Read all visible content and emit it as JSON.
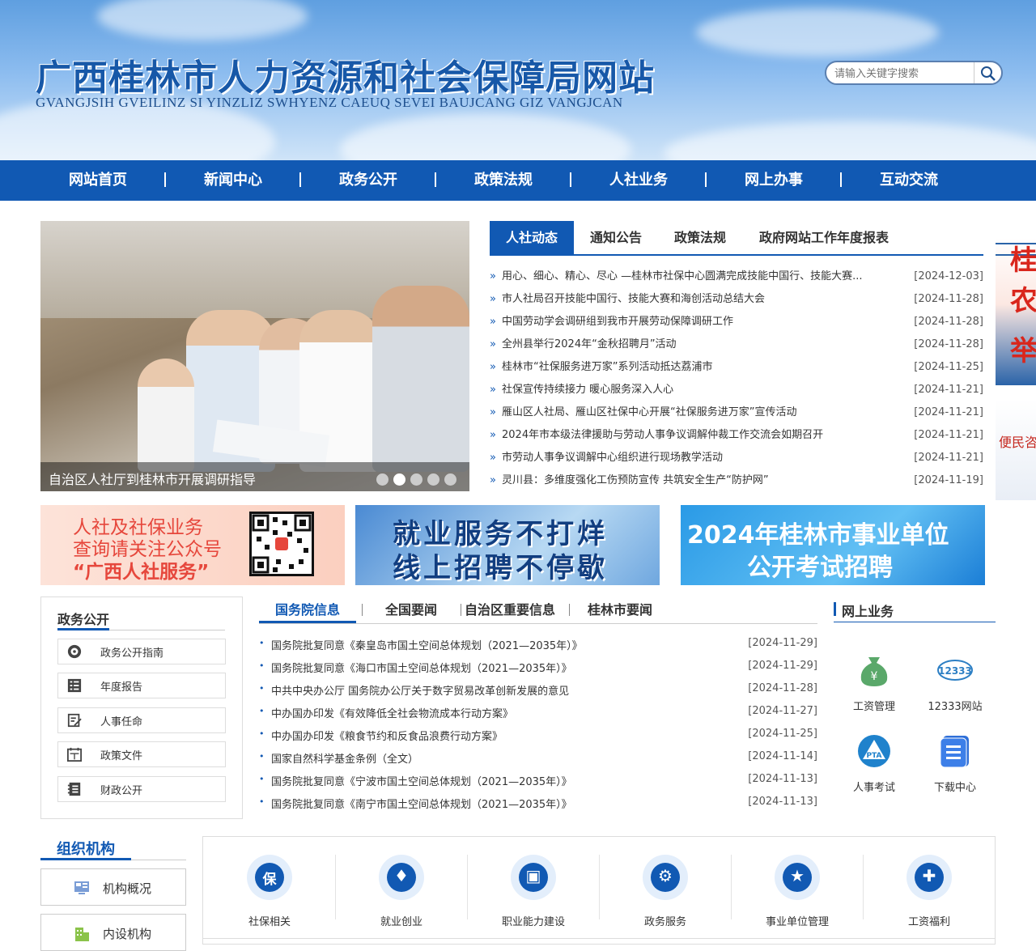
{
  "header": {
    "title": "广西桂林市人力资源和社会保障局网站",
    "subtitle": "GVANGJSIH GVEILINZ SI YINZLIZ SWHYENZ CAEUQ SEVEI BAUJCANG GIZ VANGJCAN",
    "search_placeholder": "请输入关键字搜索"
  },
  "nav": [
    "网站首页",
    "新闻中心",
    "政务公开",
    "政策法规",
    "人社业务",
    "网上办事",
    "互动交流"
  ],
  "slider": {
    "caption": "自治区人社厅到桂林市开展调研指导",
    "active_dot": 2,
    "dot_count": 5
  },
  "news_tabs": [
    "人社动态",
    "通知公告",
    "政策法规",
    "政府网站工作年度报表"
  ],
  "news": [
    {
      "title": "用心、细心、精心、尽心 —桂林市社保中心圆满完成技能中国行、技能大赛...",
      "date": "[2024-12-03]"
    },
    {
      "title": "市人社局召开技能中国行、技能大赛和海创活动总结大会",
      "date": "[2024-11-28]"
    },
    {
      "title": "中国劳动学会调研组到我市开展劳动保障调研工作",
      "date": "[2024-11-28]"
    },
    {
      "title": "全州县举行2024年“金秋招聘月”活动",
      "date": "[2024-11-28]"
    },
    {
      "title": "桂林市“社保服务进万家”系列活动抵达荔浦市",
      "date": "[2024-11-25]"
    },
    {
      "title": "社保宣传持续接力 暖心服务深入人心",
      "date": "[2024-11-21]"
    },
    {
      "title": "雁山区人社局、雁山区社保中心开展“社保服务进万家”宣传活动",
      "date": "[2024-11-21]"
    },
    {
      "title": "2024年市本级法律援助与劳动人事争议调解仲裁工作交流会如期召开",
      "date": "[2024-11-21]"
    },
    {
      "title": "市劳动人事争议调解中心组织进行现场教学活动",
      "date": "[2024-11-21]"
    },
    {
      "title": "灵川县：多维度强化工伤预防宣传 共筑安全生产“防护网”",
      "date": "[2024-11-19]"
    }
  ],
  "banners": {
    "b1": [
      "人社及社保业务",
      "查询请关注公众号",
      "“广西人社服务”"
    ],
    "b2": [
      "就业服务不打烊",
      "线上招聘不停歇"
    ],
    "b3": [
      "2024年桂林市事业单位",
      "公开考试招聘"
    ]
  },
  "float_ads": {
    "ad1": [
      "桂",
      "农",
      "举"
    ],
    "ad2": "便民咨"
  },
  "gov_open": {
    "title": "政务公开",
    "items": [
      {
        "label": "政务公开指南",
        "icon": "compass-icon"
      },
      {
        "label": "年度报告",
        "icon": "list-icon"
      },
      {
        "label": "人事任命",
        "icon": "edit-icon"
      },
      {
        "label": "政策文件",
        "icon": "calendar-icon"
      },
      {
        "label": "财政公开",
        "icon": "ledger-icon"
      }
    ]
  },
  "info_tabs": [
    "国务院信息",
    "全国要闻",
    "自治区重要信息",
    "桂林市要闻"
  ],
  "info_list": [
    {
      "title": "国务院批复同意《秦皇岛市国土空间总体规划（2021—2035年）》",
      "date": "[2024-11-29]"
    },
    {
      "title": "国务院批复同意《海口市国土空间总体规划（2021—2035年）》",
      "date": "[2024-11-29]"
    },
    {
      "title": "中共中央办公厅 国务院办公厅关于数字贸易改革创新发展的意见",
      "date": "[2024-11-28]"
    },
    {
      "title": "中办国办印发《有效降低全社会物流成本行动方案》",
      "date": "[2024-11-27]"
    },
    {
      "title": "中办国办印发《粮食节约和反食品浪费行动方案》",
      "date": "[2024-11-25]"
    },
    {
      "title": "国家自然科学基金条例（全文）",
      "date": "[2024-11-14]"
    },
    {
      "title": "国务院批复同意《宁波市国土空间总体规划（2021—2035年）》",
      "date": "[2024-11-13]"
    },
    {
      "title": "国务院批复同意《南宁市国土空间总体规划（2021—2035年）》",
      "date": "[2024-11-13]"
    }
  ],
  "online": {
    "title": "网上业务",
    "items": [
      {
        "label": "工资管理",
        "icon": "money-bag-icon",
        "color": "#5aa86a",
        "badge": "¥"
      },
      {
        "label": "12333网站",
        "icon": "12333-logo-icon",
        "color": "#2d7fc4",
        "badge": "12333"
      },
      {
        "label": "人事考试",
        "icon": "pta-logo-icon",
        "color": "#1f82cc",
        "badge": "PTA"
      },
      {
        "label": "下载中心",
        "icon": "download-book-icon",
        "color": "#2f6fd8",
        "badge": "☰"
      }
    ]
  },
  "org": {
    "title": "组织机构",
    "items": [
      {
        "label": "机构概况",
        "icon": "monitor-icon"
      },
      {
        "label": "内设机构",
        "icon": "building-icon"
      }
    ]
  },
  "business": [
    {
      "label": "社保相关",
      "icon": "shield-icon",
      "glyph": "保"
    },
    {
      "label": "就业创业",
      "icon": "tie-icon",
      "glyph": "♦"
    },
    {
      "label": "职业能力建设",
      "icon": "wallet-icon",
      "glyph": "▣"
    },
    {
      "label": "政务服务",
      "icon": "user-gear-icon",
      "glyph": "⚙"
    },
    {
      "label": "事业单位管理",
      "icon": "layers-icon",
      "glyph": "★"
    },
    {
      "label": "工资福利",
      "icon": "gift-icon",
      "glyph": "✚"
    }
  ],
  "colors": {
    "primary": "#1159b3"
  }
}
